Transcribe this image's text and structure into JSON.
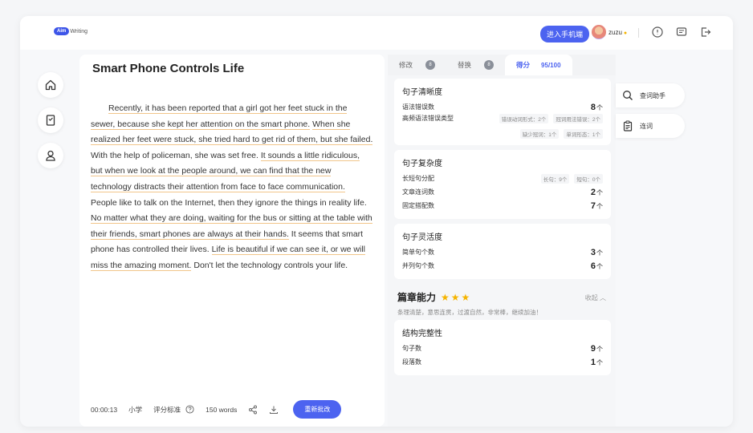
{
  "header": {
    "logo_badge": "Aim",
    "logo_text": "Writing",
    "mobile_button": "进入手机端",
    "username": "zuzu"
  },
  "nav": {
    "icons": [
      "home-icon",
      "bookmark-icon",
      "user-icon"
    ]
  },
  "editor": {
    "title": "Smart Phone Controls Life",
    "paragraph": [
      {
        "text": "Recently, it has been reported that a girl got her feet stuck in the sewer, because she kept her attention on the smart phone.",
        "underline": true
      },
      {
        "text": " ",
        "underline": false
      },
      {
        "text": "When she realized her feet were stuck, she tried hard to get rid of them, but she failed.",
        "underline": true
      },
      {
        "text": " With the help of policeman, she was set free. ",
        "underline": false
      },
      {
        "text": "It sounds a little ridiculous, but when we look at the people around, we can find that the new technology distracts their attention from face to face communication.",
        "underline": true
      },
      {
        "text": " People like to talk on the Internet, then they ignore the things in reality life. ",
        "underline": false
      },
      {
        "text": "No matter what they are doing, waiting for the bus or sitting at the table with their friends, smart phones are always at their hands.",
        "underline": true
      },
      {
        "text": " It seems that smart phone has controlled their lives. ",
        "underline": false
      },
      {
        "text": "Life is beautiful if we can see it, or we will miss the amazing moment.",
        "underline": true
      },
      {
        "text": " Don't let the technology controls your life.",
        "underline": false
      }
    ],
    "footer": {
      "timer": "00:00:13",
      "level": "小学",
      "standard": "评分标准",
      "words": "150 words",
      "recheck": "重新批改"
    }
  },
  "panel": {
    "tabs": [
      {
        "label": "修改",
        "badge": "8"
      },
      {
        "label": "替换",
        "badge": "8"
      },
      {
        "label": "得分",
        "score": "95/100"
      }
    ],
    "cards": [
      {
        "title": "句子清晰度",
        "rows": [
          {
            "label": "语法错误数",
            "value": "8",
            "unit": "个"
          },
          {
            "label": "高频语法错误类型",
            "chips": [
              "错误动词形式：2个",
              "冠词用法错误：2个",
              "缺少冠词：1个",
              "单词形态：1个"
            ]
          }
        ]
      },
      {
        "title": "句子复杂度",
        "rows": [
          {
            "label": "长短句分配",
            "chips": [
              "长句：9个",
              "短句：0个"
            ]
          },
          {
            "label": "文章连词数",
            "value": "2",
            "unit": "个"
          },
          {
            "label": "固定搭配数",
            "value": "7",
            "unit": "个"
          }
        ]
      },
      {
        "title": "句子灵活度",
        "rows": [
          {
            "label": "简单句个数",
            "value": "3",
            "unit": "个"
          },
          {
            "label": "并列句个数",
            "value": "6",
            "unit": "个"
          }
        ]
      }
    ],
    "section": {
      "title": "篇章能力",
      "stars": 3,
      "collapse": "收起",
      "desc": "条理清楚，意思连贯，过渡自然，非常棒，继续加油！",
      "card": {
        "title": "结构完整性",
        "rows": [
          {
            "label": "句子数",
            "value": "9",
            "unit": "个"
          },
          {
            "label": "段落数",
            "value": "1",
            "unit": "个"
          }
        ]
      }
    }
  },
  "tools": [
    {
      "label": "查词助手",
      "icon": "search-icon"
    },
    {
      "label": "连词",
      "icon": "clipboard-icon"
    }
  ],
  "colors": {
    "accent": "#4c63f0",
    "underline": "#f1c58a",
    "star": "#f5b400"
  }
}
